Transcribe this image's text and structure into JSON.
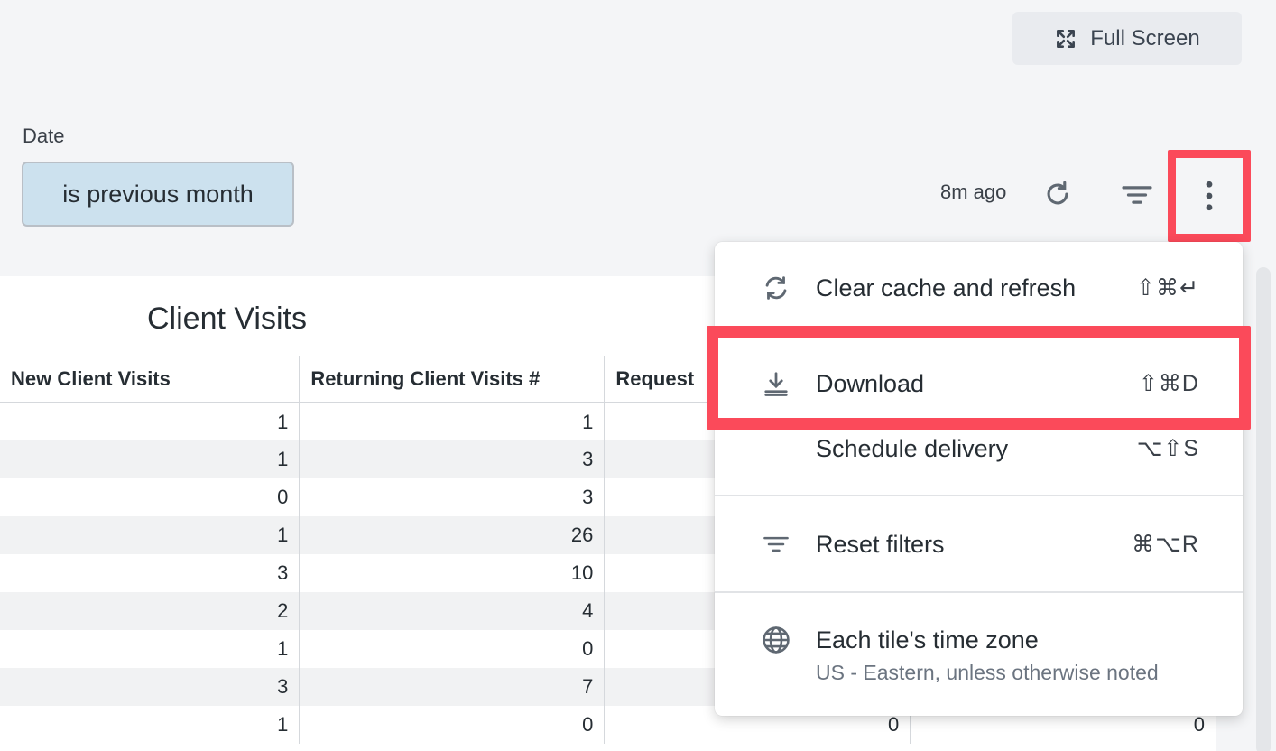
{
  "toolbar": {
    "fullscreen_label": "Full Screen",
    "updated_ago": "8m ago"
  },
  "filters": {
    "date_label": "Date",
    "date_value": "is previous month"
  },
  "tile": {
    "title": "Client Visits",
    "columns": [
      "New Client Visits",
      "Returning Client Visits #",
      "Request",
      ""
    ],
    "rows": [
      [
        "1",
        "1",
        "",
        ""
      ],
      [
        "1",
        "3",
        "",
        ""
      ],
      [
        "0",
        "3",
        "",
        ""
      ],
      [
        "1",
        "26",
        "",
        ""
      ],
      [
        "3",
        "10",
        "",
        ""
      ],
      [
        "2",
        "4",
        "",
        ""
      ],
      [
        "1",
        "0",
        "",
        ""
      ],
      [
        "3",
        "7",
        "",
        ""
      ],
      [
        "1",
        "0",
        "0",
        "0"
      ]
    ]
  },
  "menu": {
    "items": [
      {
        "label": "Clear cache and refresh",
        "shortcut": "⇧⌘↵",
        "icon": "refresh-arrows-icon"
      },
      {
        "label": "Download",
        "shortcut": "⇧⌘D",
        "icon": "download-icon"
      },
      {
        "label": "Schedule delivery",
        "shortcut": "⌥⇧S",
        "icon": ""
      },
      {
        "label": "Reset filters",
        "shortcut": "⌘⌥R",
        "icon": "filter-lines-icon"
      },
      {
        "label": "Each tile's time zone",
        "sublabel": "US - Eastern, unless otherwise noted",
        "icon": "globe-icon"
      }
    ]
  },
  "colors": {
    "highlight": "#fb4a5a",
    "chip_bg": "#cce1ee",
    "page_bg": "#f4f5f7"
  }
}
